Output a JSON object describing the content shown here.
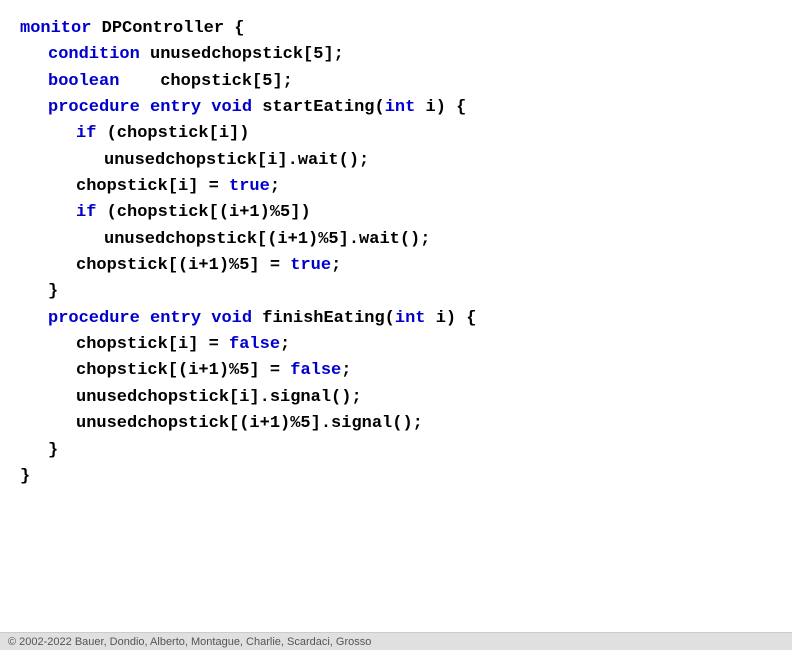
{
  "code": {
    "lines": [
      {
        "id": "line1",
        "indent": 0,
        "parts": [
          {
            "text": "monitor ",
            "color": "blue"
          },
          {
            "text": "DPController {",
            "color": "black"
          }
        ]
      },
      {
        "id": "line2",
        "indent": 1,
        "parts": [
          {
            "text": "condition ",
            "color": "blue"
          },
          {
            "text": "unusedchopstick[5];",
            "color": "black"
          }
        ]
      },
      {
        "id": "line3",
        "indent": 1,
        "parts": [
          {
            "text": "boolean",
            "color": "blue"
          },
          {
            "text": "    chopstick[5];",
            "color": "black"
          }
        ]
      },
      {
        "id": "line4",
        "indent": 1,
        "parts": [
          {
            "text": "procedure ",
            "color": "blue"
          },
          {
            "text": "entry ",
            "color": "blue"
          },
          {
            "text": "void ",
            "color": "blue"
          },
          {
            "text": "startEating(",
            "color": "black"
          },
          {
            "text": "int ",
            "color": "blue"
          },
          {
            "text": "i) {",
            "color": "black"
          }
        ]
      },
      {
        "id": "line5",
        "indent": 2,
        "parts": [
          {
            "text": "if ",
            "color": "blue"
          },
          {
            "text": "(chopstick[i])",
            "color": "black"
          }
        ]
      },
      {
        "id": "line6",
        "indent": 3,
        "parts": [
          {
            "text": "unusedchopstick[i].wait();",
            "color": "black"
          }
        ]
      },
      {
        "id": "line7",
        "indent": 2,
        "parts": [
          {
            "text": "chopstick[i] = ",
            "color": "black"
          },
          {
            "text": "true",
            "color": "blue"
          },
          {
            "text": ";",
            "color": "black"
          }
        ]
      },
      {
        "id": "line8",
        "indent": 2,
        "parts": [
          {
            "text": "if ",
            "color": "blue"
          },
          {
            "text": "(chopstick[(i+1)%5])",
            "color": "black"
          }
        ]
      },
      {
        "id": "line9",
        "indent": 3,
        "parts": [
          {
            "text": "unusedchopstick[(i+1)%5].wait();",
            "color": "black"
          }
        ]
      },
      {
        "id": "line10",
        "indent": 2,
        "parts": [
          {
            "text": "chopstick[(i+1)%5] = ",
            "color": "black"
          },
          {
            "text": "true",
            "color": "blue"
          },
          {
            "text": ";",
            "color": "black"
          }
        ]
      },
      {
        "id": "line11",
        "indent": 1,
        "parts": [
          {
            "text": "}",
            "color": "black"
          }
        ]
      },
      {
        "id": "line12",
        "indent": 1,
        "parts": [
          {
            "text": "procedure ",
            "color": "blue"
          },
          {
            "text": "entry ",
            "color": "blue"
          },
          {
            "text": "void ",
            "color": "blue"
          },
          {
            "text": "finishEating(",
            "color": "black"
          },
          {
            "text": "int ",
            "color": "blue"
          },
          {
            "text": "i) {",
            "color": "black"
          }
        ]
      },
      {
        "id": "line13",
        "indent": 2,
        "parts": [
          {
            "text": "chopstick[i] = ",
            "color": "black"
          },
          {
            "text": "false",
            "color": "blue"
          },
          {
            "text": ";",
            "color": "black"
          }
        ]
      },
      {
        "id": "line14",
        "indent": 2,
        "parts": [
          {
            "text": "chopstick[(i+1)%5] = ",
            "color": "black"
          },
          {
            "text": "false",
            "color": "blue"
          },
          {
            "text": ";",
            "color": "black"
          }
        ]
      },
      {
        "id": "line15",
        "indent": 2,
        "parts": [
          {
            "text": "unusedchopstick[i].signal();",
            "color": "black"
          }
        ]
      },
      {
        "id": "line16",
        "indent": 2,
        "parts": [
          {
            "text": "unusedchopstick[(i+1)%5].signal();",
            "color": "black"
          }
        ]
      },
      {
        "id": "line17",
        "indent": 1,
        "parts": [
          {
            "text": "}",
            "color": "black"
          }
        ]
      },
      {
        "id": "line18",
        "indent": 0,
        "parts": [
          {
            "text": "}",
            "color": "black"
          }
        ]
      }
    ]
  },
  "footer": {
    "text": "© 2002-2022 Bauer, Dondio, Alberto, Montague, Charlie, Scardaci, Grosso"
  }
}
